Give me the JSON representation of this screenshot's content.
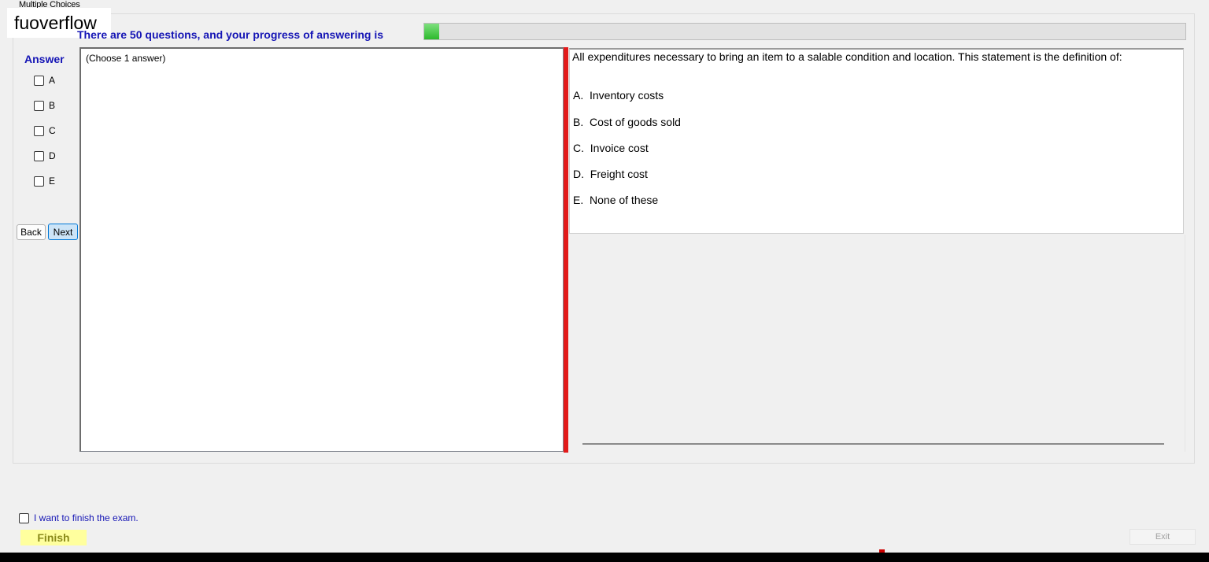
{
  "window": {
    "group_title": "Multiple Choices"
  },
  "watermark": {
    "text": "fuoverflow"
  },
  "header": {
    "progress_text": "There are 50 questions, and your progress of answering is",
    "progress_fraction": 0.02,
    "progress_color": "#2cb92c"
  },
  "answer": {
    "heading": "Answer",
    "options": [
      "A",
      "B",
      "C",
      "D",
      "E"
    ]
  },
  "nav": {
    "back_label": "Back",
    "next_label": "Next"
  },
  "left_panel": {
    "hint": "(Choose 1 answer)"
  },
  "question": {
    "text": "All expenditures necessary to bring an item to a salable condition and location. This statement is the definition of:",
    "choices": [
      "A.  Inventory costs",
      "B.  Cost of goods sold",
      "C.  Invoice cost",
      "D.  Freight cost",
      "E.  None of these"
    ]
  },
  "footer": {
    "finish_check_label": "I want to finish the exam.",
    "finish_label": "Finish",
    "exit_label": "Exit"
  },
  "colors": {
    "accent_blue": "#1515b5",
    "splitter_red": "#e21a1a",
    "finish_yellow": "#ffff9e"
  }
}
